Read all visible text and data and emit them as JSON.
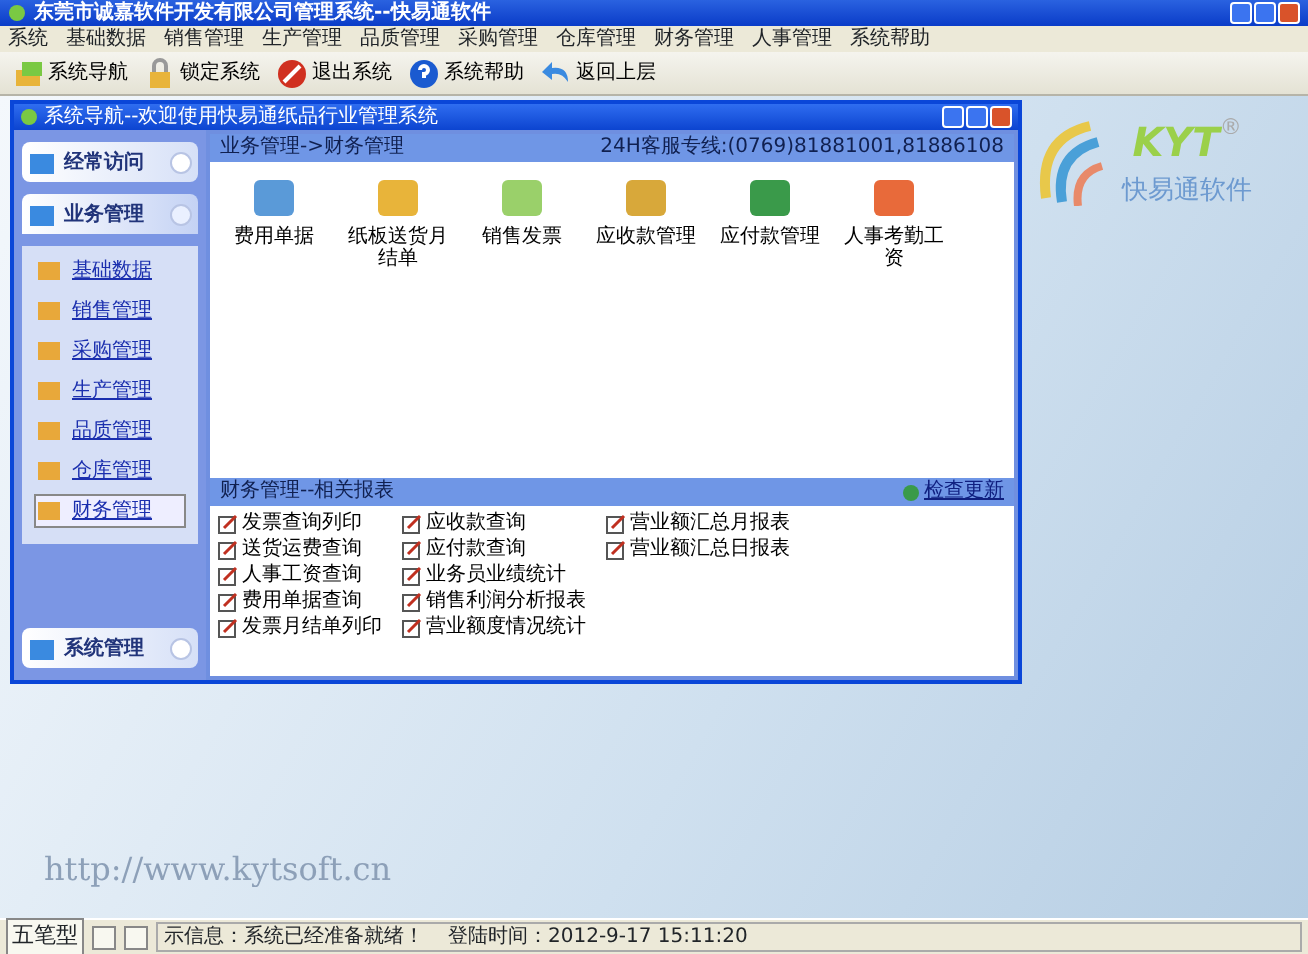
{
  "window": {
    "title": "东莞市诚嘉软件开发有限公司管理系统--快易通软件"
  },
  "menu": [
    "系统",
    "基础数据",
    "销售管理",
    "生产管理",
    "品质管理",
    "采购管理",
    "仓库管理",
    "财务管理",
    "人事管理",
    "系统帮助"
  ],
  "toolbar": [
    {
      "label": "系统导航",
      "kind": "boxes"
    },
    {
      "label": "锁定系统",
      "kind": "lock"
    },
    {
      "label": "退出系统",
      "kind": "exit"
    },
    {
      "label": "系统帮助",
      "kind": "help"
    },
    {
      "label": "返回上层",
      "kind": "back"
    }
  ],
  "child_window": {
    "title": "系统导航--欢迎使用快易通纸品行业管理系统",
    "sidebar": [
      {
        "label": "经常访问",
        "expanded": false
      },
      {
        "label": "业务管理",
        "expanded": true,
        "items": [
          {
            "label": "基础数据",
            "selected": false
          },
          {
            "label": "销售管理",
            "selected": false
          },
          {
            "label": "采购管理",
            "selected": false
          },
          {
            "label": "生产管理",
            "selected": false
          },
          {
            "label": "品质管理",
            "selected": false
          },
          {
            "label": "仓库管理",
            "selected": false
          },
          {
            "label": "财务管理",
            "selected": true
          }
        ]
      },
      {
        "label": "系统管理",
        "expanded": false
      }
    ],
    "breadcrumb": "业务管理->财务管理",
    "hotline": "24H客服专线:(0769)81881001,81886108",
    "modules": [
      "费用单据",
      "纸板送货月结单",
      "销售发票",
      "应收款管理",
      "应付款管理",
      "人事考勤工资"
    ],
    "reports": {
      "title": "财务管理--相关报表",
      "update_link": "检查更新",
      "columns": [
        [
          "发票查询列印",
          "送货运费查询",
          "人事工资查询",
          "费用单据查询",
          "发票月结单列印"
        ],
        [
          "应收款查询",
          "应付款查询",
          "业务员业绩统计",
          "销售利润分析报表",
          "营业额度情况统计"
        ],
        [
          "营业额汇总月报表",
          "营业额汇总日报表"
        ]
      ]
    }
  },
  "logo": {
    "mark": "KYT",
    "registered": "®",
    "name": "快易通软件"
  },
  "website": "http://www.kytsoft.cn",
  "status_bar": {
    "ime": "五笔型",
    "message": "示信息：系统已经准备就绪！",
    "login_time": "登陆时间：2012-9-17 15:11:20"
  }
}
